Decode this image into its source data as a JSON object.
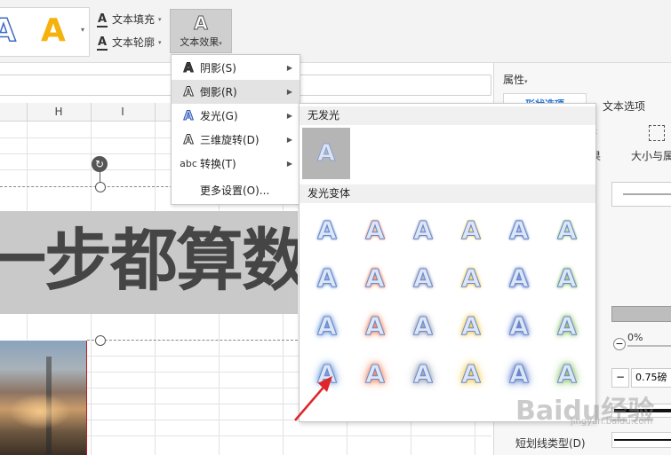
{
  "ribbon": {
    "text_fill_label": "文本填充",
    "text_outline_label": "文本轮廓",
    "text_effect_label": "文本效果",
    "text_effect_glyph": "A",
    "wordart_glyph": "A",
    "fill_glyph": "A",
    "outline_glyph": "A",
    "dropdown_glyph": "▾",
    "caret_glyph": "▾"
  },
  "sheet": {
    "columns": [
      "H",
      "I"
    ],
    "wordart_text": "一步都算数"
  },
  "menu": {
    "items": [
      {
        "label": "阴影(S)",
        "icon": "A",
        "arrow": "▶"
      },
      {
        "label": "倒影(R)",
        "icon": "A",
        "arrow": "▶"
      },
      {
        "label": "发光(G)",
        "icon": "A",
        "arrow": "▶"
      },
      {
        "label": "三维旋转(D)",
        "icon": "A",
        "arrow": "▶"
      },
      {
        "label": "转换(T)",
        "icon": "abc",
        "arrow": "▶"
      },
      {
        "label": "更多设置(O)..."
      }
    ]
  },
  "glow": {
    "no_glow_title": "无发光",
    "variants_title": "发光变体",
    "cell_glyph": "A",
    "colors": [
      "#5b8fd8",
      "#ed7d4e",
      "#8d99ad",
      "#f2c744",
      "#4f73c8",
      "#7fbf5c"
    ],
    "sizes": [
      3,
      5,
      8,
      11
    ]
  },
  "panel": {
    "title": "属性",
    "title_caret": "▾",
    "tab_shape": "形状选项",
    "tab_text": "文本选项",
    "subtab_effect": "果",
    "subtab_size": "大小与属",
    "transparency": "0%",
    "width_value": "0.75磅",
    "minus_glyph": "−",
    "dash_type_label": "短划线类型(D)"
  },
  "watermark": {
    "text": "Baidu经验",
    "sub": "jingyan.baidu.com"
  }
}
